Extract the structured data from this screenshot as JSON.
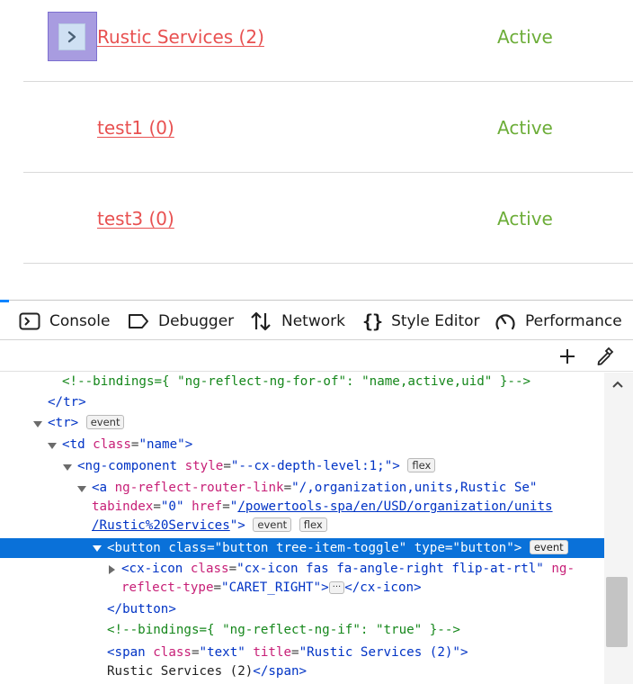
{
  "page": {
    "rows": [
      {
        "name": "Rustic Services (2)",
        "status": "Active"
      },
      {
        "name": "test1 (0)",
        "status": "Active"
      },
      {
        "name": "test3 (0)",
        "status": "Active"
      }
    ],
    "toggle_glyph": "›"
  },
  "devtools": {
    "tabs": [
      {
        "label": "Console",
        "icon": "console-icon"
      },
      {
        "label": "Debugger",
        "icon": "debugger-icon"
      },
      {
        "label": "Network",
        "icon": "network-icon"
      },
      {
        "label": "Style Editor",
        "icon": "style-editor-icon"
      },
      {
        "label": "Performance",
        "icon": "performance-icon"
      }
    ],
    "toolbar": {
      "add_icon": "plus-icon",
      "picker_icon": "eyedropper-icon"
    },
    "markup": {
      "l1_comment": "<!--bindings={ \"ng-reflect-ng-for-of\": \"name,active,uid\" }-->",
      "l2_tag": "</tr>",
      "l3_open": "<tr>",
      "l3_badge": "event",
      "l4_open": "<td",
      "l4_attr": "class",
      "l4_val": "\"name\"",
      "l4_close": ">",
      "l5_open": "<ng-component",
      "l5_attr": "style",
      "l5_val": "\"--cx-depth-level:1;\"",
      "l5_close": ">",
      "l5_badge": "flex",
      "l6_open": "<a",
      "l6_attr": "ng-reflect-router-link",
      "l6_val": "\"/,organization,units,Rustic Se\"",
      "l7_attr1": "tabindex",
      "l7_val1": "\"0\"",
      "l7_attr2": "href",
      "l7_q": "\"",
      "l7_link": "/powertools-spa/en/USD/organization/units",
      "l8_link": "/Rustic%20Services",
      "l8_q": "\"",
      "l8_close": ">",
      "l8_badge1": "event",
      "l8_badge2": "flex",
      "l9_open": "<button",
      "l9_attr1": "class",
      "l9_val1": "\"button tree-item-toggle\"",
      "l9_attr2": "type",
      "l9_val2": "\"button\"",
      "l9_close": ">",
      "l9_badge": "event",
      "l10_open": "<cx-icon",
      "l10_attr1": "class",
      "l10_val1": "\"cx-icon fas fa-angle-right flip-at-rtl\"",
      "l10_attr2": "ng-",
      "l11_attr": "reflect-type",
      "l11_val": "\"CARET_RIGHT\"",
      "l11_close": ">",
      "l11_ellipsis": "···",
      "l11_end": "</cx-icon>",
      "l12_tag": "</button>",
      "l13_comment": "<!--bindings={ \"ng-reflect-ng-if\": \"true\" }-->",
      "l14_open": "<span",
      "l14_attr1": "class",
      "l14_val1": "\"text\"",
      "l14_attr2": "title",
      "l14_val2": "\"Rustic Services (2)\"",
      "l14_close": ">",
      "l15_text": "Rustic Services (2)",
      "l15_end": "</span>"
    }
  }
}
